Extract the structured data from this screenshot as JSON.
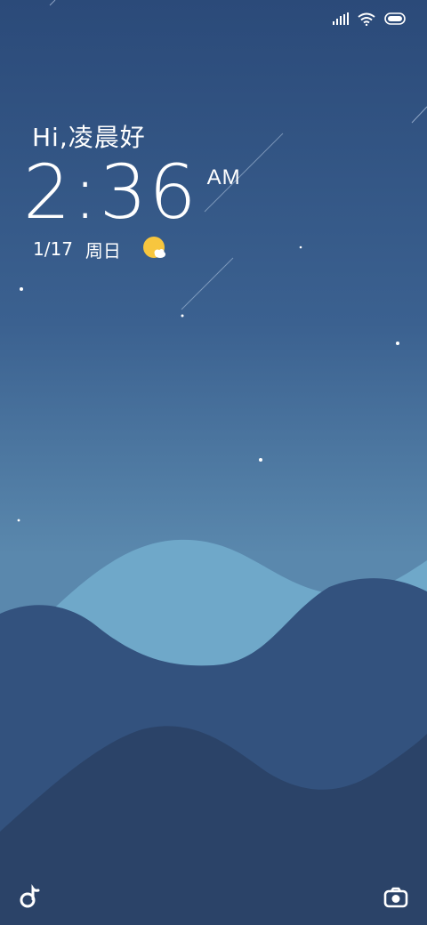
{
  "status_bar": {
    "icons": [
      "signal-icon",
      "wifi-icon",
      "battery-icon"
    ]
  },
  "lockscreen": {
    "greeting": "Hi,凌晨好",
    "time": "2:36",
    "ampm": "AM",
    "date": "1/17",
    "weekday": "周日",
    "weather_icon": "partly-cloudy-icon"
  },
  "shortcuts": {
    "left_icon": "music-icon",
    "right_icon": "camera-icon"
  },
  "colors": {
    "sky_top": "#2c4b7a",
    "sky_bottom": "#6ea6c6",
    "hill_light": "#6ea6c6",
    "hill_mid": "#33527e",
    "hill_dark": "#2b4368",
    "sun": "#f7c63e"
  }
}
